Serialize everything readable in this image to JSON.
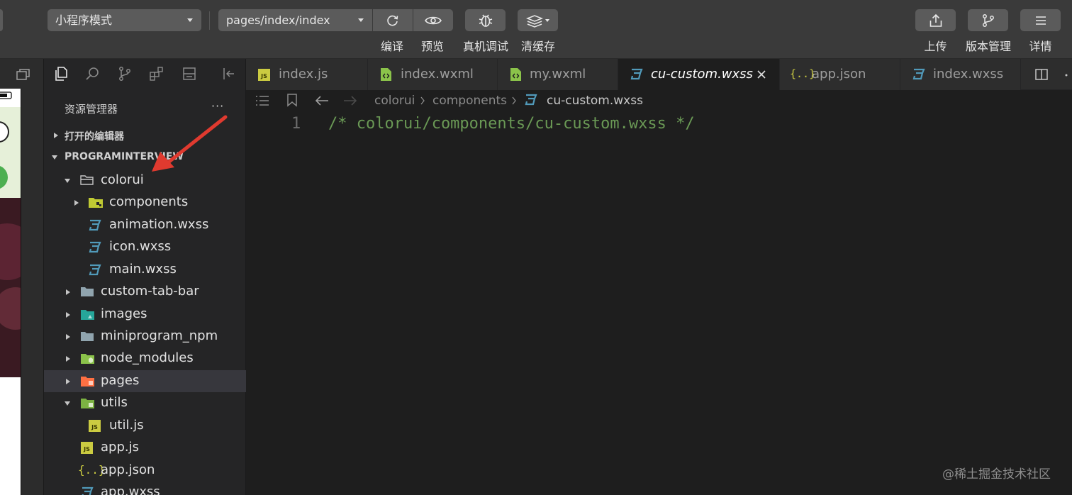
{
  "toolbar": {
    "mode_select": "小程序模式",
    "page_select": "pages/index/index",
    "labels": {
      "compile": "编译",
      "preview": "预览",
      "device_debug": "真机调试",
      "clear_cache": "清缓存",
      "upload": "上传",
      "version_manage": "版本管理",
      "details": "详情"
    },
    "icons": [
      "refresh-icon",
      "eye-icon",
      "bug-icon",
      "layers-icon",
      "upload-icon",
      "branch-icon",
      "menu-icon"
    ]
  },
  "explorer": {
    "title": "资源管理器",
    "more": "···",
    "open_editors": "打开的编辑器",
    "project": "PROGRAMINTERVIEW",
    "tree": [
      {
        "label": "colorui",
        "type": "folder-open"
      },
      {
        "label": "components",
        "type": "folder-components"
      },
      {
        "label": "animation.wxss",
        "type": "wxss"
      },
      {
        "label": "icon.wxss",
        "type": "wxss"
      },
      {
        "label": "main.wxss",
        "type": "wxss"
      },
      {
        "label": "custom-tab-bar",
        "type": "folder"
      },
      {
        "label": "images",
        "type": "folder-images"
      },
      {
        "label": "miniprogram_npm",
        "type": "folder"
      },
      {
        "label": "node_modules",
        "type": "folder-node"
      },
      {
        "label": "pages",
        "type": "folder-pages"
      },
      {
        "label": "utils",
        "type": "folder-utils"
      },
      {
        "label": "util.js",
        "type": "js"
      },
      {
        "label": "app.js",
        "type": "js"
      },
      {
        "label": "app.json",
        "type": "json"
      },
      {
        "label": "app.wxss",
        "type": "wxss"
      }
    ]
  },
  "tabs": [
    {
      "label": "index.js",
      "type": "js"
    },
    {
      "label": "index.wxml",
      "type": "wxml"
    },
    {
      "label": "my.wxml",
      "type": "wxml"
    },
    {
      "label": "cu-custom.wxss",
      "type": "wxss",
      "active": true
    },
    {
      "label": "app.json",
      "type": "json"
    },
    {
      "label": "index.wxss",
      "type": "wxss"
    }
  ],
  "breadcrumb": {
    "part1": "colorui",
    "part2": "components",
    "file": "cu-custom.wxss"
  },
  "editor": {
    "line_number": "1",
    "code": "/* colorui/components/cu-custom.wxss */"
  },
  "icon_badges": {
    "js": "JS",
    "json": "{..}"
  },
  "watermark": "@稀土掘金技术社区",
  "colors": {
    "accent_blue": "#519aba",
    "js_yellow": "#cbcb41",
    "comment_green": "#6a9955",
    "arrow_red": "#e03a2f"
  }
}
